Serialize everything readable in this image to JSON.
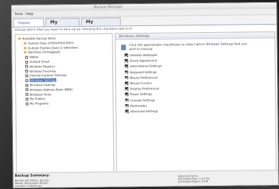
{
  "app_title": "Backup Manager",
  "menu": [
    "Tools",
    "Help"
  ],
  "tabs": [
    "Prepare Backup",
    "My Folders",
    "My Programs"
  ],
  "instruction": "Choose which files you want to back up by checking the checkbox next to it",
  "tree": [
    {
      "label": "Available Backup Items",
      "kind": "root"
    },
    {
      "label": "Outlook Data (2000/2002/2003)",
      "kind": "folder"
    },
    {
      "label": "Outlook Express Data (2 Identities)",
      "kind": "folder"
    },
    {
      "label": "Identities (Unmapped)",
      "kind": "folder"
    },
    {
      "label": "Wab/a",
      "kind": "check"
    },
    {
      "label": "Outlook Email",
      "kind": "check"
    },
    {
      "label": "Windows Registry",
      "kind": "check"
    },
    {
      "label": "Windows Favorites",
      "kind": "check"
    },
    {
      "label": "Internet Explorer Settings",
      "kind": "check"
    },
    {
      "label": "Windows Settings",
      "kind": "check",
      "selected": true
    },
    {
      "label": "Windows Desktop",
      "kind": "check"
    },
    {
      "label": "Windows Address Book (WAB)",
      "kind": "check"
    },
    {
      "label": "Windows Fonts",
      "kind": "check"
    },
    {
      "label": "My Folders",
      "kind": "check"
    },
    {
      "label": "My Programs",
      "kind": "check"
    }
  ],
  "right_header": "Windows Settings",
  "hint": "Click the appropriate checkboxes to select which Windows Settings that you wish to backup",
  "settings": [
    "Desktop Wallpaper",
    "Visual Appearance",
    "International Settings",
    "Keyboard Settings",
    "Mouse Preferences",
    "Mouse Cursors",
    "Display Preferences",
    "Power Settings",
    "Console Settings",
    "Multimedia",
    "Advanced Settings"
  ],
  "summary": {
    "title": "Backup Summary:",
    "left_lines": [
      "Backup Job Name: Backup",
      "Media: Removable Media",
      "Location: E:\\Backups"
    ],
    "right_lines": [
      "Selected Items:",
      "Estimated Size: 1.42 Gb",
      "Estimated Space: 4 GB"
    ]
  }
}
